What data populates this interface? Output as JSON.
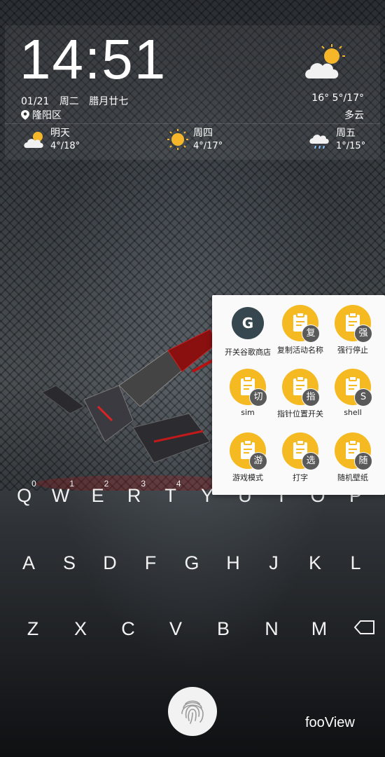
{
  "lockscreen": {
    "time": "14:51",
    "date": "01/21",
    "weekday": "周二",
    "lunar": "腊月廿七",
    "location": "隆阳区",
    "current_temp": "16°  5°/17°",
    "current_condition": "多云",
    "current_icon": "partly-cloudy-icon"
  },
  "forecast": [
    {
      "day": "明天",
      "range": "4°/18°",
      "icon": "partly-cloudy-icon"
    },
    {
      "day": "周四",
      "range": "4°/17°",
      "icon": "sunny-icon"
    },
    {
      "day": "周五",
      "range": "1°/15°",
      "icon": "rain-icon"
    }
  ],
  "keyboard": {
    "row1": [
      {
        "k": "Q",
        "n": "0"
      },
      {
        "k": "W",
        "n": "1"
      },
      {
        "k": "E",
        "n": "2"
      },
      {
        "k": "R",
        "n": "3"
      },
      {
        "k": "T",
        "n": "4"
      },
      {
        "k": "Y",
        "n": ""
      },
      {
        "k": "U",
        "n": ""
      },
      {
        "k": "I",
        "n": ""
      },
      {
        "k": "O",
        "n": ""
      },
      {
        "k": "P",
        "n": ""
      }
    ],
    "row2": [
      "A",
      "S",
      "D",
      "F",
      "G",
      "H",
      "J",
      "K",
      "L"
    ],
    "row3": [
      "Z",
      "X",
      "C",
      "V",
      "B",
      "N",
      "M"
    ]
  },
  "popup": {
    "tiles": [
      {
        "label": "开关谷歌商店",
        "badge": "G",
        "style": "dark"
      },
      {
        "label": "复制活动名称",
        "badge": "复",
        "style": "yellow"
      },
      {
        "label": "强行停止",
        "badge": "强",
        "style": "yellow"
      },
      {
        "label": "sim",
        "badge": "切",
        "style": "yellow"
      },
      {
        "label": "指针位置开关",
        "badge": "指",
        "style": "yellow"
      },
      {
        "label": "shell",
        "badge": "S",
        "style": "yellow"
      },
      {
        "label": "游戏模式",
        "badge": "游",
        "style": "yellow"
      },
      {
        "label": "打字",
        "badge": "选",
        "style": "yellow"
      },
      {
        "label": "随机壁纸",
        "badge": "随",
        "style": "yellow"
      }
    ]
  },
  "watermark": "fooView",
  "colors": {
    "tile_yellow": "#f5b921",
    "tile_dark": "#37474f",
    "popup_bg": "#fafafa"
  }
}
